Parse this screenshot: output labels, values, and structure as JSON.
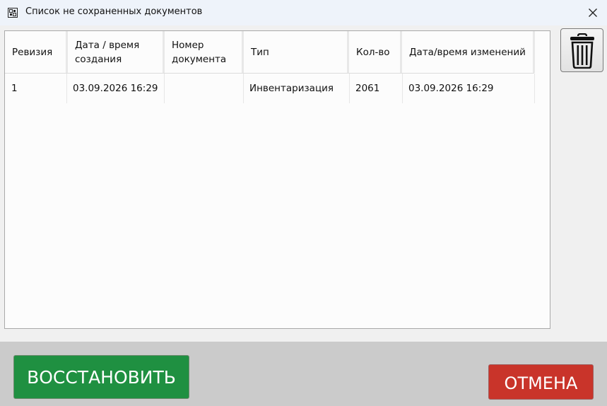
{
  "window": {
    "title": "Список не сохраненных документов",
    "icon": "grid-app-icon",
    "close_icon": "close-icon"
  },
  "table": {
    "columns": [
      {
        "label": "Ревизия"
      },
      {
        "label": "Дата / время создания"
      },
      {
        "label": "Номер документа"
      },
      {
        "label": "Тип"
      },
      {
        "label": "Кол-во"
      },
      {
        "label": "Дата/время изменений"
      }
    ],
    "rows": [
      [
        "1",
        "03.09.2026 16:29",
        "",
        "Инвентаризация",
        "2061",
        "03.09.2026 16:29"
      ]
    ]
  },
  "toolbar": {
    "delete_icon": "trash-icon"
  },
  "footer": {
    "restore_label": "ВОССТАНОВИТЬ",
    "cancel_label": "ОТМЕНА",
    "restore_color": "#1f9041",
    "cancel_color": "#c9342a"
  }
}
